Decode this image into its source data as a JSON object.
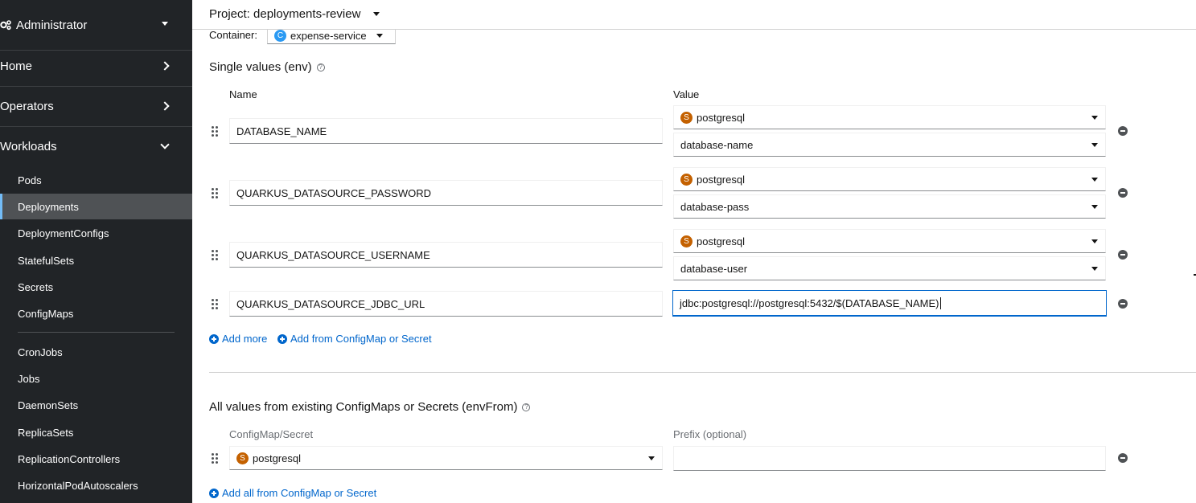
{
  "sidebar": {
    "perspective": "Administrator",
    "sections": [
      {
        "label": "Home",
        "expanded": false
      },
      {
        "label": "Operators",
        "expanded": false
      },
      {
        "label": "Workloads",
        "expanded": true
      }
    ],
    "workloads_items": [
      "Pods",
      "Deployments",
      "DeploymentConfigs",
      "StatefulSets",
      "Secrets",
      "ConfigMaps",
      "CronJobs",
      "Jobs",
      "DaemonSets",
      "ReplicaSets",
      "ReplicationControllers",
      "HorizontalPodAutoscalers"
    ],
    "active_item": "Deployments"
  },
  "header": {
    "project_label": "Project: deployments-review"
  },
  "container": {
    "label": "Container:",
    "badge": "C",
    "value": "expense-service"
  },
  "env": {
    "title": "Single values (env)",
    "help_icon": "question-circle-icon",
    "name_header": "Name",
    "value_header": "Value",
    "rows": [
      {
        "name": "DATABASE_NAME",
        "source_badge": "S",
        "source": "postgresql",
        "key": "database-name"
      },
      {
        "name": "QUARKUS_DATASOURCE_PASSWORD",
        "source_badge": "S",
        "source": "postgresql",
        "key": "database-pass"
      },
      {
        "name": "QUARKUS_DATASOURCE_USERNAME",
        "source_badge": "S",
        "source": "postgresql",
        "key": "database-user"
      },
      {
        "name": "QUARKUS_DATASOURCE_JDBC_URL",
        "value": "jdbc:postgresql://postgresql:5432/$(DATABASE_NAME)"
      }
    ],
    "add_more": "Add more",
    "add_from": "Add from ConfigMap or Secret"
  },
  "env_from": {
    "title": "All values from existing ConfigMaps or Secrets (envFrom)",
    "configmap_header": "ConfigMap/Secret",
    "prefix_header": "Prefix (optional)",
    "rows": [
      {
        "source_badge": "S",
        "source": "postgresql",
        "prefix": ""
      }
    ],
    "add_all": "Add all from ConfigMap or Secret"
  },
  "colors": {
    "sidebar_bg": "#212427",
    "active_bg": "#4f5255",
    "link": "#0066cc",
    "badge_s": "#c46100",
    "badge_c": "#2b9af3"
  }
}
